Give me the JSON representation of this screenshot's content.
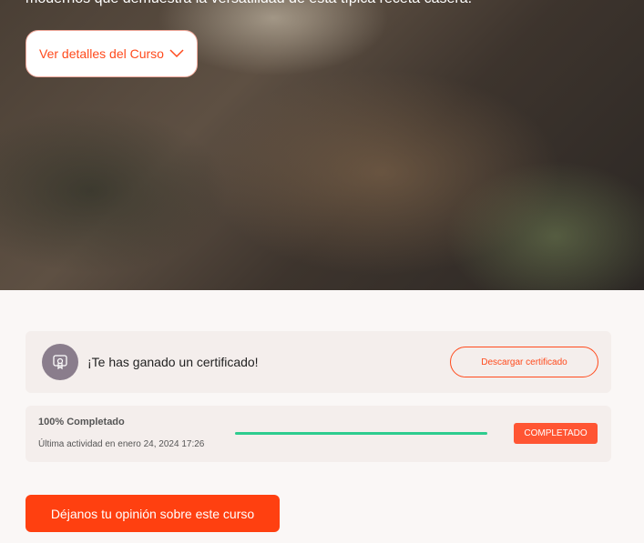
{
  "hero": {
    "description_fragment": "modernos que demuestra la versatilidad de esta típica receta casera.",
    "details_button_label": "Ver detalles del Curso",
    "details_button_icon": "chevron-down-icon"
  },
  "certificate": {
    "icon": "certificate-icon",
    "title": "¡Te has ganado un certificado!",
    "download_label": "Descargar certificado"
  },
  "progress": {
    "completed_label": "100% Completado",
    "last_activity": "Última actividad en enero 24, 2024 17:26",
    "percent": 100,
    "status": "COMPLETADO"
  },
  "review": {
    "button_label": "Déjanos tu opinión sobre este curso"
  },
  "colors": {
    "accent": "#ff4a1c",
    "progress_fill": "#2ecc8f",
    "status_badge": "#ff5533",
    "avatar": "#8a7d8c"
  }
}
